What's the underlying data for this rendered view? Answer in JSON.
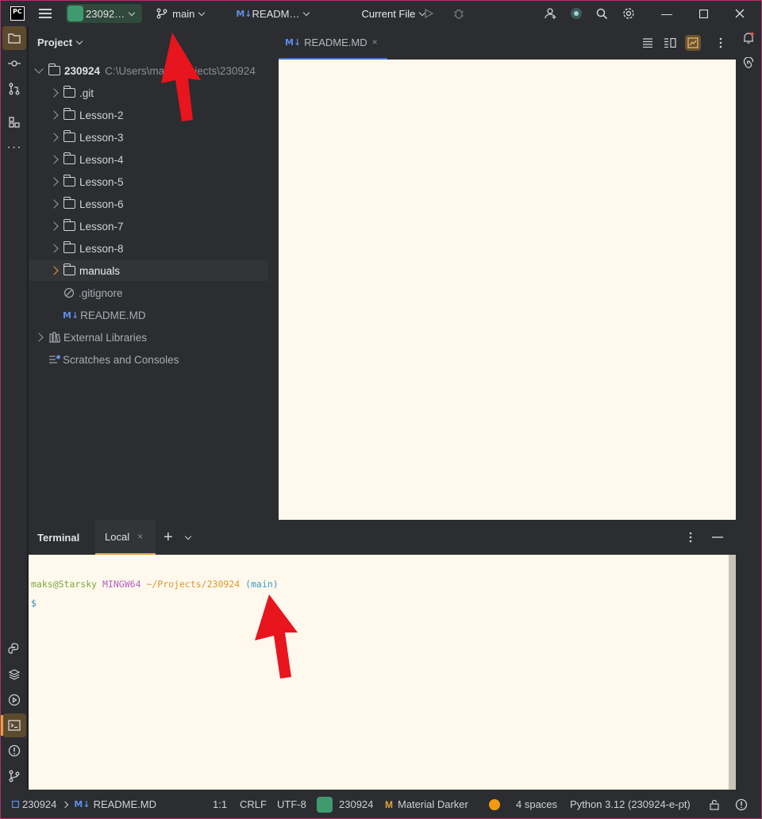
{
  "titlebar": {
    "project_label": "23092…",
    "branch_label": "main",
    "file_label": "READM…",
    "file_badge": "M↓",
    "run_config": "Current File",
    "logo": "PC"
  },
  "project_panel": {
    "title": "Project",
    "root_name": "230924",
    "root_path": "C:\\Users\\maks\\Projects\\230924",
    "folders": [
      ".git",
      "Lesson-2",
      "Lesson-3",
      "Lesson-4",
      "Lesson-5",
      "Lesson-6",
      "Lesson-7",
      "Lesson-8",
      "manuals"
    ],
    "files": [
      ".gitignore",
      "README.MD"
    ],
    "file_badge": "M↓",
    "external_libraries": "External Libraries",
    "scratches": "Scratches and Consoles"
  },
  "editor": {
    "tab_label": "README.MD",
    "tab_badge": "M↓",
    "tab_close": "×"
  },
  "terminal": {
    "title": "Terminal",
    "tab_label": "Local",
    "tab_close": "×",
    "prompt_user": "maks@Starsky",
    "prompt_system": "MINGW64",
    "prompt_path": "~/Projects/230924",
    "prompt_branch": "(main)",
    "prompt_symbol": "$"
  },
  "statusbar": {
    "breadcrumb_project": "230924",
    "breadcrumb_file": "README.MD",
    "file_badge": "M↓",
    "position": "1:1",
    "line_endings": "CRLF",
    "encoding": "UTF-8",
    "module": "230924",
    "theme": "Material Darker",
    "indent": "4 spaces",
    "interpreter": "Python 3.12 (230924-e-pt)"
  },
  "colors": {
    "accent": "#e4a43c",
    "editor_bg": "#fff8ec",
    "prompt_user": "#7aa83f",
    "prompt_system": "#b060c8",
    "prompt_path": "#d69a2f",
    "prompt_branch": "#3a9bc8",
    "arrow_red": "#e8141e"
  }
}
